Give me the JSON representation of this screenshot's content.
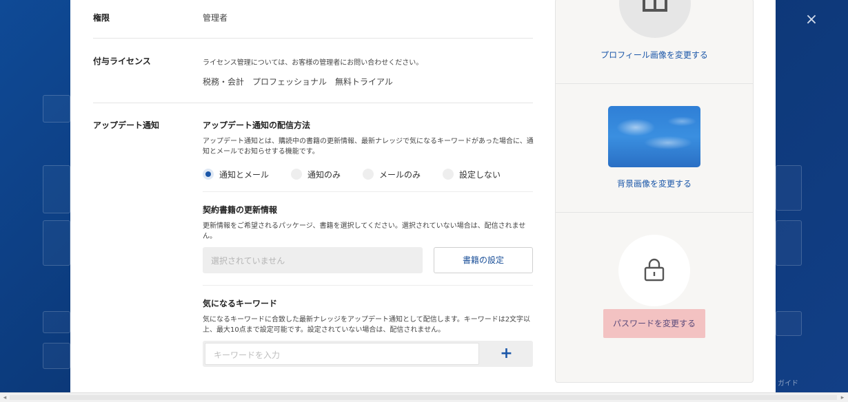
{
  "window": {
    "close_label": "×"
  },
  "backdrop": {
    "footer_text": "ガイド"
  },
  "fields": {
    "permission": {
      "label": "権限",
      "value": "管理者"
    },
    "license": {
      "label": "付与ライセンス",
      "note": "ライセンス管理については、お客様の管理者にお問い合わせください。",
      "value": "税務・会計　プロフェッショナル　無料トライアル"
    },
    "update": {
      "label": "アップデート通知"
    }
  },
  "delivery": {
    "title": "アップデート通知の配信方法",
    "description": "アップデート通知とは、購読中の書籍の更新情報、最新ナレッジで気になるキーワードがあった場合に、通知とメールでお知らせする機能です。",
    "options": [
      {
        "label": "通知とメール",
        "selected": true
      },
      {
        "label": "通知のみ",
        "selected": false
      },
      {
        "label": "メールのみ",
        "selected": false
      },
      {
        "label": "設定しない",
        "selected": false
      }
    ]
  },
  "books": {
    "title": "契約書籍の更新情報",
    "description": "更新情報をご希望されるパッケージ、書籍を選択してください。選択されていない場合は、配信されません。",
    "selection_placeholder": "選択されていません",
    "settings_button": "書籍の設定"
  },
  "keywords": {
    "title": "気になるキーワード",
    "description": "気になるキーワードに合致した最新ナレッジをアップデート通知として配信します。キーワードは2文字以上、最大10点まで設定可能です。設定されていない場合は、配信されません。",
    "input_placeholder": "キーワードを入力",
    "add_label": "+"
  },
  "profile_panel": {
    "change_profile_image": "プロフィール画像を変更する",
    "change_background_image": "背景画像を変更する",
    "change_password": "パスワードを変更する"
  },
  "scrollbar": {
    "left_arrow": "◂",
    "right_arrow": "▸"
  },
  "colors": {
    "accent": "#1a56a8",
    "password_button_bg": "#f3c2c2",
    "panel_bg": "#f7f6f4"
  }
}
